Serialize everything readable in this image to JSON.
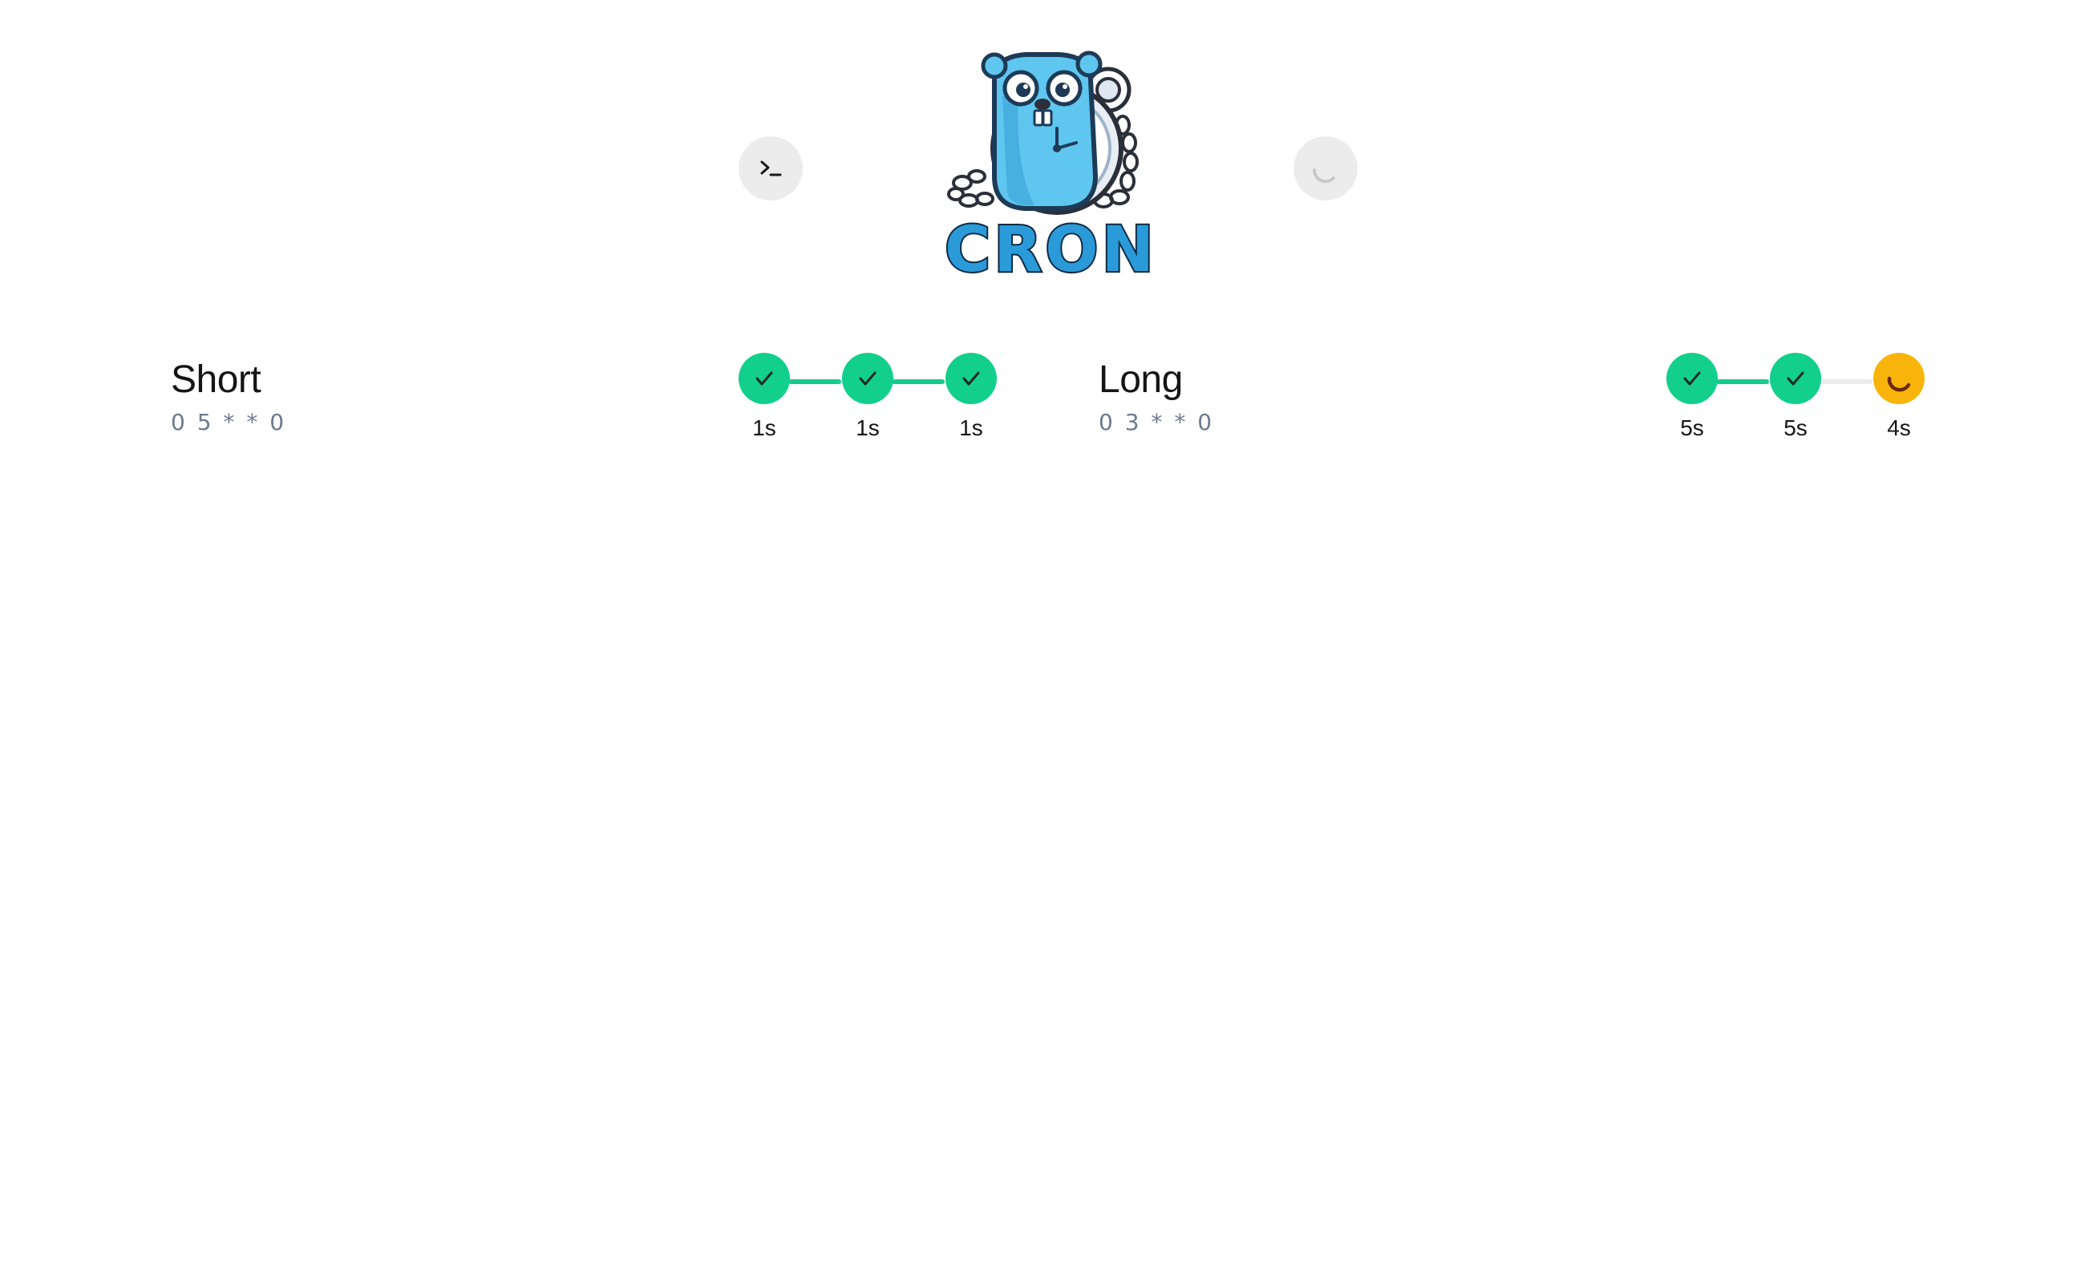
{
  "header": {
    "logo_text": "CRON",
    "terminal_button_icon": "terminal-icon",
    "status_button_icon": "loading-spinner-icon"
  },
  "colors": {
    "success": "#12cf8c",
    "running": "#f8b40a",
    "connector_done": "#14cc8e",
    "connector_pending": "#ececec",
    "schedule_text": "#6b7a90",
    "button_bg": "#ececec"
  },
  "jobs": [
    {
      "name": "Short",
      "schedule": "0 5 * * 0",
      "runs": [
        {
          "status": "success",
          "duration": "1s"
        },
        {
          "status": "success",
          "duration": "1s"
        },
        {
          "status": "success",
          "duration": "1s"
        }
      ]
    },
    {
      "name": "Long",
      "schedule": "0 3 * * 0",
      "runs": [
        {
          "status": "success",
          "duration": "5s"
        },
        {
          "status": "success",
          "duration": "5s"
        },
        {
          "status": "running",
          "duration": "4s"
        }
      ]
    }
  ]
}
